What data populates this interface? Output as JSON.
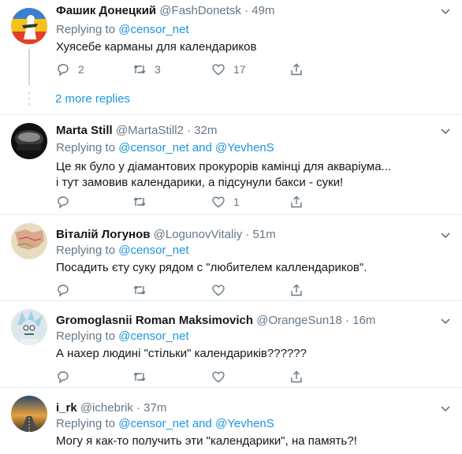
{
  "tweets": [
    {
      "name": "Фашик Донецкий",
      "handle": "@FashDonetsk",
      "time": "49m",
      "replying_prefix": "Replying to ",
      "mentions": "@censor_net",
      "text": "Хуясебе карманы для календариков",
      "replies": "2",
      "retweets": "3",
      "likes": "17"
    },
    {
      "name": "Marta Still",
      "handle": "@MartaStill2",
      "time": "32m",
      "replying_prefix": "Replying to ",
      "mentions": "@censor_net and @YevhenS",
      "text": "Це як було у діамантових прокурорів камінці для акваріума...\nі тут замовив календарики, а підсунули бакси - суки!",
      "replies": "",
      "retweets": "",
      "likes": "1"
    },
    {
      "name": "Віталій Логунов",
      "handle": "@LogunovVitaliy",
      "time": "51m",
      "replying_prefix": "Replying to ",
      "mentions": "@censor_net",
      "text": "Посадить єту суку рядом с \"любителем каллендариков\".",
      "replies": "",
      "retweets": "",
      "likes": ""
    },
    {
      "name": "Gromoglasnii Roman Maksimovich",
      "handle": "@OrangeSun18",
      "time": "16m",
      "replying_prefix": "Replying to ",
      "mentions": "@censor_net",
      "text": "А нахер людині \"стільки\" календариків??????",
      "replies": "",
      "retweets": "",
      "likes": ""
    },
    {
      "name": "i_rk",
      "handle": "@ichebrik",
      "time": "37m",
      "replying_prefix": "Replying to ",
      "mentions": "@censor_net and @YevhenS",
      "text": "Могу я как-то получить эти \"календарики\", на память?!",
      "replies": "",
      "retweets": "",
      "likes": ""
    }
  ],
  "thread": {
    "more_replies": "2 more replies"
  },
  "colors": {
    "accent": "#1b95e0",
    "muted": "#657786",
    "text": "#14171a",
    "divider": "#e6ecf0"
  }
}
